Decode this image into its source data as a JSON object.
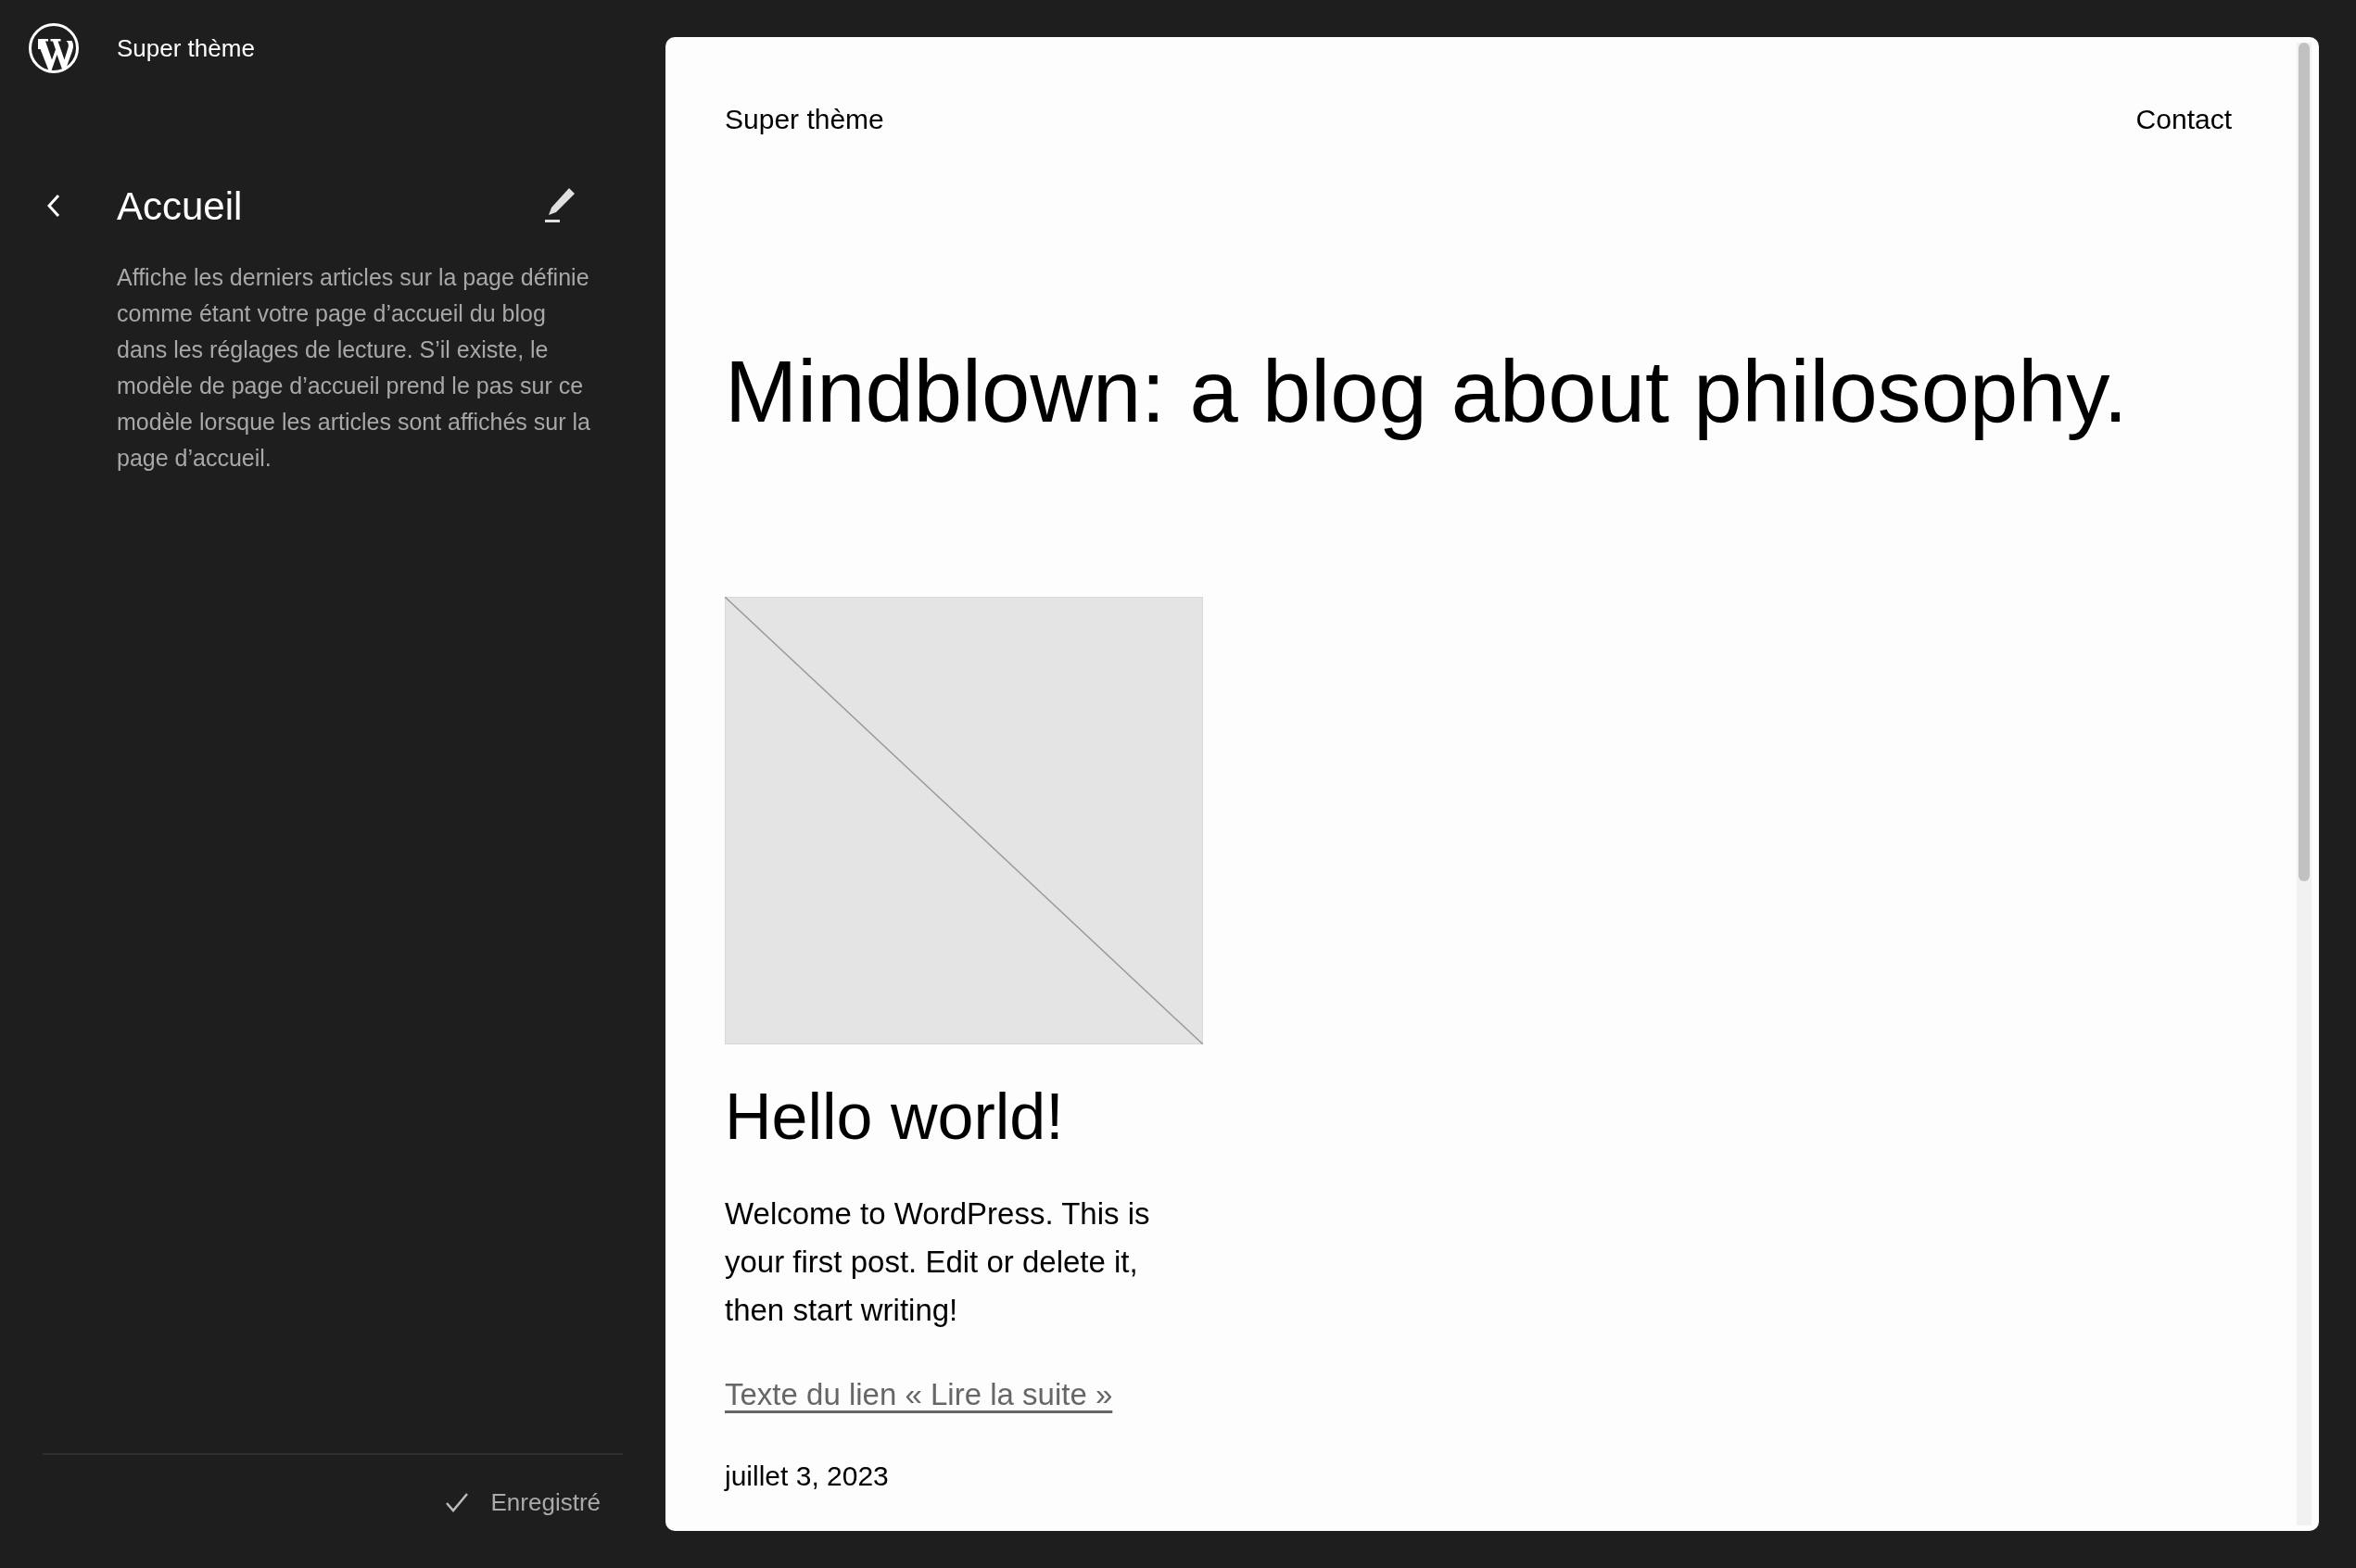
{
  "sidebar": {
    "site_title": "Super thème",
    "page_title": "Accueil",
    "description": "Affiche les derniers articles sur la page définie comme étant votre page d’accueil du blog dans les réglages de lecture. S’il existe, le modèle de page d’accueil prend le pas sur ce modèle lorsque les articles sont affichés sur la page d’accueil.",
    "save_status": "Enregistré"
  },
  "preview": {
    "site_title": "Super thème",
    "nav": [
      "Contact"
    ],
    "heading": "Mindblown: a blog about philosophy.",
    "posts": [
      {
        "title": "Hello world!",
        "excerpt": "Welcome to WordPress. This is your first post. Edit or delete it, then start writing!",
        "read_more": "Texte du lien « Lire la suite »",
        "date": "juillet 3, 2023"
      }
    ]
  }
}
